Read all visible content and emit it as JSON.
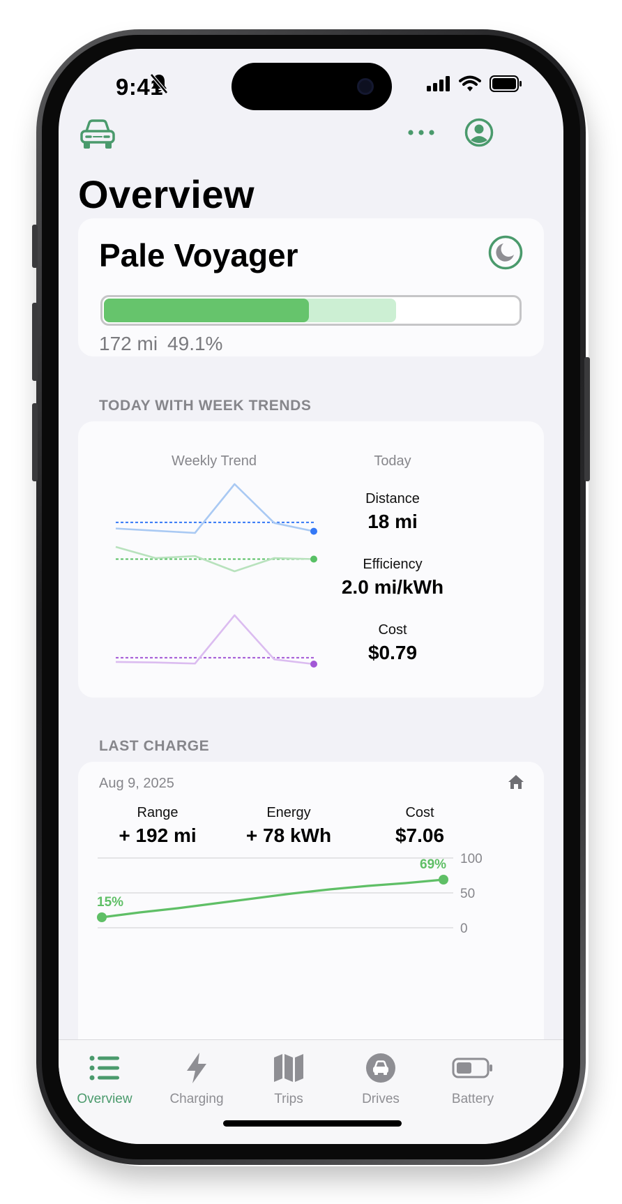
{
  "status_bar": {
    "time": "9:41"
  },
  "header": {
    "title": "Overview"
  },
  "vehicle": {
    "name": "Pale Voyager",
    "range": "172 mi",
    "percent": "49.1%",
    "battery_level": 0.491,
    "charge_limit": 0.7
  },
  "trends": {
    "section_title": "TODAY WITH WEEK TRENDS",
    "weekly_trend_label": "Weekly Trend",
    "today_label": "Today",
    "metrics": [
      {
        "label": "Distance",
        "value": "18 mi",
        "color": "#3478f6",
        "light_color": "#a9c9f3",
        "weekly": [
          2,
          1.6,
          1.2,
          10,
          3,
          1.5
        ],
        "average": 3.1
      },
      {
        "label": "Efficiency",
        "value": "2.0 mi/kWh",
        "color": "#58c065",
        "light_color": "#b8e2bd",
        "weekly": [
          2.6,
          2.05,
          2.15,
          1.4,
          2.05,
          2.0
        ],
        "average": 2.0
      },
      {
        "label": "Cost",
        "value": "$0.79",
        "color": "#a257d6",
        "light_color": "#dbbcf0",
        "weekly": [
          1.2,
          1.1,
          0.9,
          10,
          1.7,
          0.8
        ],
        "average": 2.0
      }
    ]
  },
  "last_charge": {
    "section_title": "LAST CHARGE",
    "date": "Aug 9, 2025",
    "location_icon": "house-icon",
    "stats": [
      {
        "label": "Range",
        "value": "+ 192 mi"
      },
      {
        "label": "Energy",
        "value": "+ 78 kWh"
      },
      {
        "label": "Cost",
        "value": "$7.06"
      }
    ],
    "chart_data": {
      "type": "line",
      "y_ticks": [
        "100",
        "50",
        "0"
      ],
      "ylim": [
        0,
        100
      ],
      "start_label": "15%",
      "end_label": "69%",
      "series": [
        {
          "values": [
            15,
            22,
            28,
            35,
            42,
            49,
            55,
            60,
            64,
            69
          ]
        }
      ],
      "color": "#5fbf66"
    }
  },
  "tabs": [
    {
      "label": "Overview",
      "icon": "list-icon",
      "active": true
    },
    {
      "label": "Charging",
      "icon": "bolt-icon"
    },
    {
      "label": "Trips",
      "icon": "map-icon"
    },
    {
      "label": "Drives",
      "icon": "car-circle-icon"
    },
    {
      "label": "Battery",
      "icon": "battery-icon"
    }
  ],
  "colors": {
    "accent": "#4a9a6c",
    "background": "#f2f2f7",
    "card": "#fbfbfd"
  }
}
